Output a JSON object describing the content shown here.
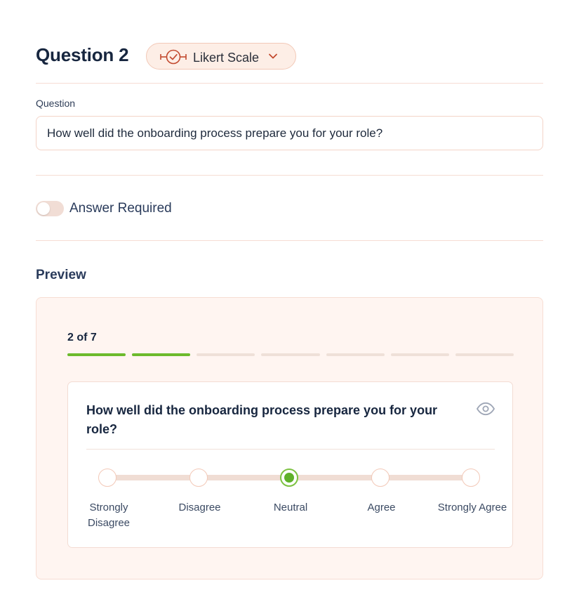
{
  "header": {
    "title": "Question 2",
    "type_label": "Likert Scale",
    "type_icon": "likert-scale-icon",
    "dropdown_icon": "chevron-down-icon"
  },
  "question_field": {
    "label": "Question",
    "value": "How well did the onboarding process prepare you for your role?"
  },
  "answer_required": {
    "label": "Answer Required",
    "enabled": false
  },
  "preview": {
    "title": "Preview",
    "step_text": "2 of 7",
    "progress": {
      "completed": 2,
      "total": 7
    },
    "question": "How well did the onboarding process prepare you for your role?",
    "visibility_icon": "eye-icon",
    "options": [
      "Strongly Disagree",
      "Disagree",
      "Neutral",
      "Agree",
      "Strongly Agree"
    ],
    "selected_index": 2
  },
  "colors": {
    "accent_green": "#6cba2c",
    "pill_background": "#fdeee6",
    "pill_icon": "#c2492e",
    "preview_background": "#fff5f1",
    "text_dark": "#17263f"
  }
}
